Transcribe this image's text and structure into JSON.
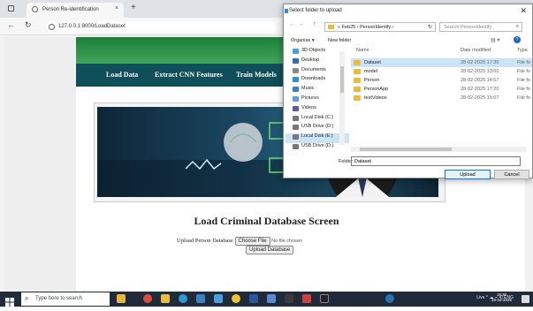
{
  "browser": {
    "tab_title": "Person Re-identification",
    "tab_close": "×",
    "new_tab": "+",
    "url": "127.0.0.1:8000/LoadDataset"
  },
  "nav": {
    "items": [
      {
        "label": "Load Data"
      },
      {
        "label": "Extract CNN Features"
      },
      {
        "label": "Train Models"
      }
    ]
  },
  "page": {
    "title": "Load Criminal Database Screen",
    "upload_label": "Upload Person Database",
    "choose_file": "Choose File",
    "no_file": "No file chosen",
    "upload_button": "Upload Database"
  },
  "dialog": {
    "title": "Select folder to upload",
    "close": "✕",
    "path": "« Feb25 › PersonIdentify ›",
    "search_placeholder": "Search PersonIdentify",
    "organise": "Organise ▾",
    "new_folder": "New folder",
    "tree": [
      {
        "label": "3D Objects",
        "color": "#4a9ee0"
      },
      {
        "label": "Desktop",
        "color": "#2e6fb0"
      },
      {
        "label": "Documents",
        "color": "#8a8a8a"
      },
      {
        "label": "Downloads",
        "color": "#2f8fd6"
      },
      {
        "label": "Music",
        "color": "#3c7fcf"
      },
      {
        "label": "Pictures",
        "color": "#5aa0de"
      },
      {
        "label": "Videos",
        "color": "#5b5b9a"
      },
      {
        "label": "Local Disk (C:)",
        "color": "#777777"
      },
      {
        "label": "USB Drive (D:)",
        "color": "#777777"
      },
      {
        "label": "Local Disk (E:)",
        "color": "#777777",
        "selected": true
      },
      {
        "label": "USB Drive (D:)",
        "color": "#777777"
      }
    ],
    "columns": {
      "name": "Name",
      "date": "Date modified",
      "type": "Type"
    },
    "files": [
      {
        "name": "Dataset",
        "date": "28-02-2025 17:30",
        "type": "File fo",
        "selected": true
      },
      {
        "name": "model",
        "date": "28-02-2025 13:00",
        "type": "File fo"
      },
      {
        "name": "Person",
        "date": "28-02-2025 14:57",
        "type": "File fo"
      },
      {
        "name": "PersonApp",
        "date": "28-02-2025 17:20",
        "type": "File fo"
      },
      {
        "name": "testVideos",
        "date": "28-02-2025 15:07",
        "type": "File fo"
      }
    ],
    "folder_label": "Folder:",
    "folder_value": "Dataset",
    "select_button": "Upload",
    "cancel_button": "Cancel"
  },
  "taskbar": {
    "search_placeholder": "Type here to search",
    "tray_text": "Live  ^ ☁ ⌁ 4) ENG",
    "time": "18:30",
    "date": "28-02-2025"
  },
  "colors": {
    "header_green": "#2e8f48",
    "nav_teal": "#0f4f59",
    "taskbar": "#1f2a3a",
    "selection": "#cce4f7"
  }
}
